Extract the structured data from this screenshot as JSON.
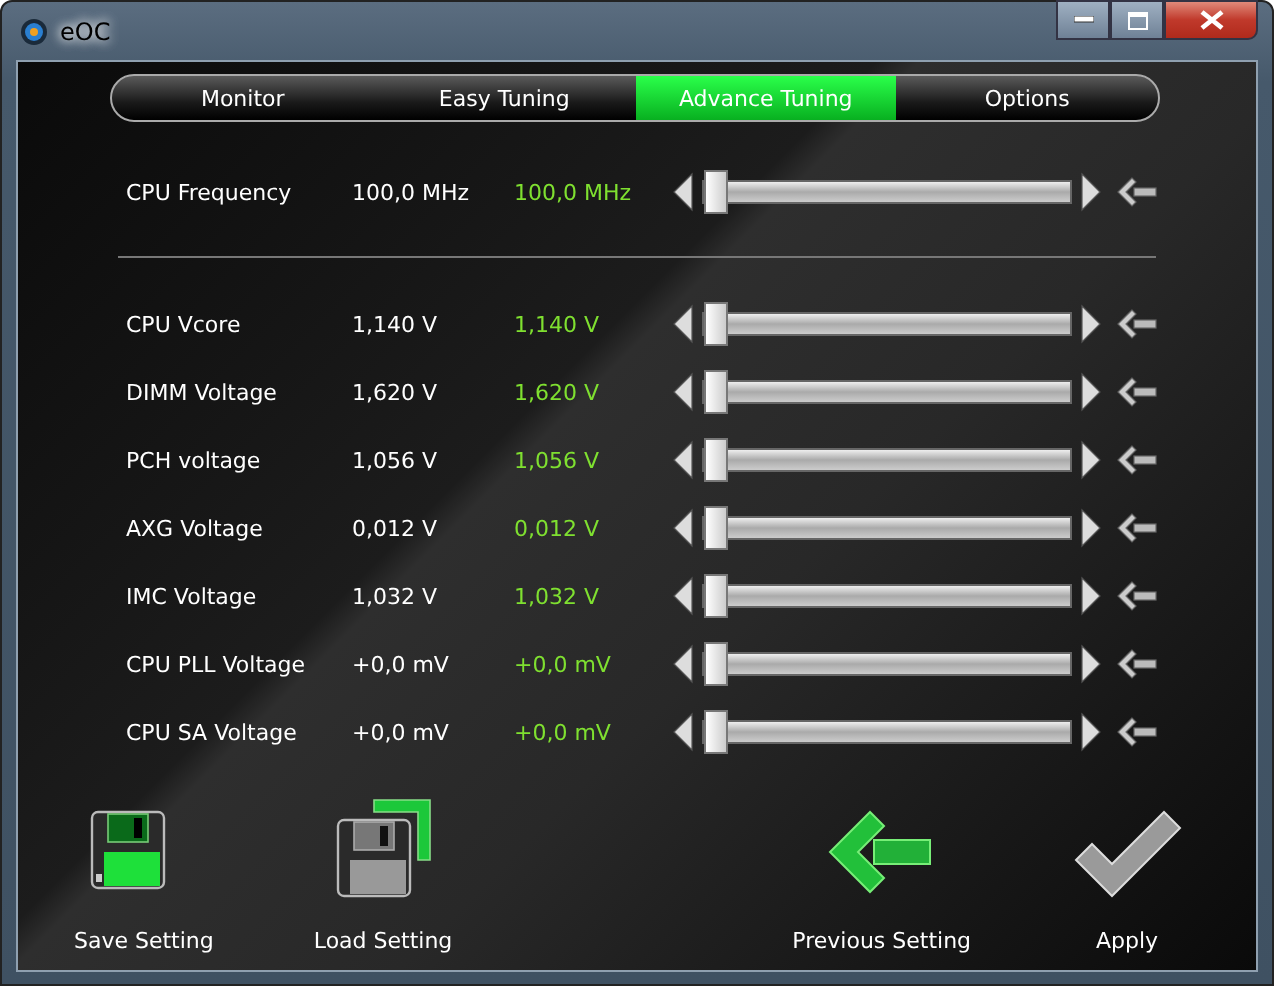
{
  "window": {
    "title": "eOC"
  },
  "tabs": [
    {
      "label": "Monitor",
      "selected": false
    },
    {
      "label": "Easy Tuning",
      "selected": false
    },
    {
      "label": "Advance Tuning",
      "selected": true
    },
    {
      "label": "Options",
      "selected": false
    }
  ],
  "frequency": {
    "name": "CPU Frequency",
    "current": "100,0 MHz",
    "target": "100,0 MHz",
    "level": 0.0
  },
  "voltages": [
    {
      "name": "CPU Vcore",
      "current": "1,140 V",
      "target": "1,140 V",
      "level": 0.0
    },
    {
      "name": "DIMM Voltage",
      "current": "1,620 V",
      "target": "1,620 V",
      "level": 0.0
    },
    {
      "name": "PCH voltage",
      "current": "1,056 V",
      "target": "1,056 V",
      "level": 0.0
    },
    {
      "name": "AXG Voltage",
      "current": "0,012 V",
      "target": "0,012 V",
      "level": 0.0
    },
    {
      "name": "IMC Voltage",
      "current": "1,032 V",
      "target": "1,032 V",
      "level": 0.0
    },
    {
      "name": "CPU PLL Voltage",
      "current": "+0,0 mV",
      "target": "+0,0 mV",
      "level": 0.0
    },
    {
      "name": "CPU SA Voltage",
      "current": "+0,0 mV",
      "target": "+0,0 mV",
      "level": 0.0
    }
  ],
  "actions": [
    {
      "kind": "save",
      "label": "Save Setting"
    },
    {
      "kind": "load",
      "label": "Load Setting"
    },
    {
      "kind": "previous",
      "label": "Previous Setting"
    },
    {
      "kind": "apply",
      "label": "Apply"
    }
  ]
}
